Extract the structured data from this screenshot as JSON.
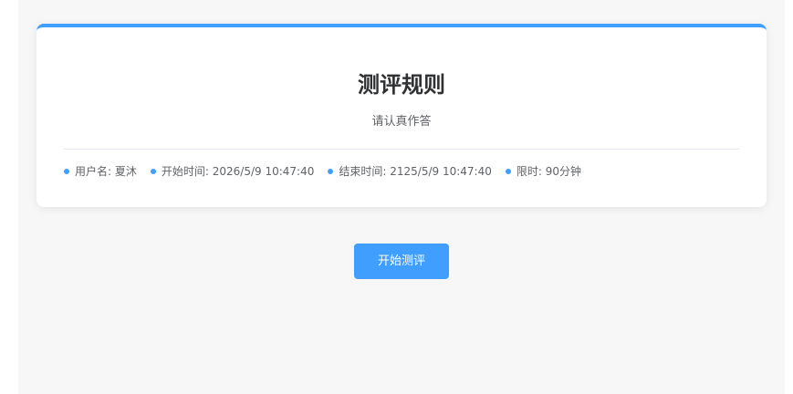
{
  "card": {
    "title": "测评规则",
    "subtitle": "请认真作答",
    "info": [
      {
        "label": "用户名:",
        "value": "夏沐"
      },
      {
        "label": "开始时间:",
        "value": "2026/5/9 10:47:40"
      },
      {
        "label": "结束时间:",
        "value": "2125/5/9 10:47:40"
      },
      {
        "label": "限时:",
        "value": "90分钟"
      }
    ]
  },
  "actions": {
    "start_label": "开始测评"
  },
  "colors": {
    "accent": "#409eff",
    "background": "#f7f7f7",
    "card": "#ffffff"
  }
}
